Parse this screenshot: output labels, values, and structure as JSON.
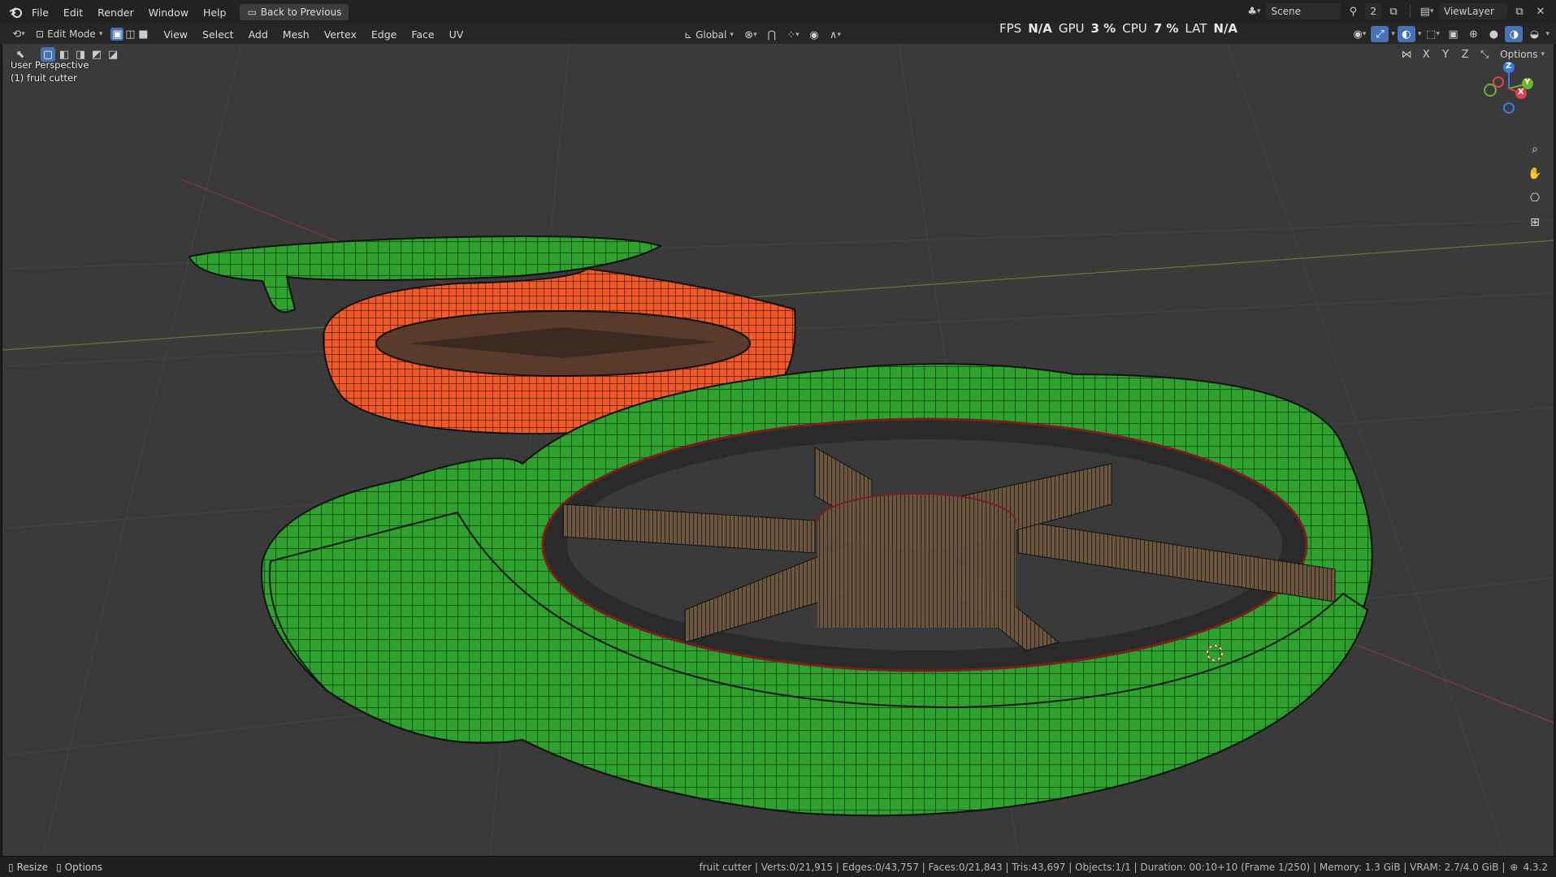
{
  "topbar": {
    "menus": [
      "File",
      "Edit",
      "Render",
      "Window",
      "Help"
    ],
    "back_button": "Back to Previous",
    "scene_label": "Scene",
    "scene_users": "2",
    "viewlayer_label": "ViewLayer"
  },
  "header": {
    "mode": "Edit Mode",
    "menus": [
      "View",
      "Select",
      "Add",
      "Mesh",
      "Vertex",
      "Edge",
      "Face",
      "UV"
    ],
    "orientation": "Global",
    "options_label": "Options",
    "axes": [
      "X",
      "Y",
      "Z"
    ]
  },
  "perf": {
    "fps_label": "FPS",
    "fps_value": "N/A",
    "gpu_label": "GPU",
    "gpu_value": "3 %",
    "cpu_label": "CPU",
    "cpu_value": "7 %",
    "lat_label": "LAT",
    "lat_value": "N/A"
  },
  "viewport": {
    "perspective": "User Perspective",
    "object": "(1) fruit cutter"
  },
  "gizmo": {
    "x": "X",
    "y": "Y",
    "z": "Z"
  },
  "statusbar": {
    "resize": "Resize",
    "options": "Options",
    "stats": "fruit cutter | Verts:0/21,915 | Edges:0/43,757 | Faces:0/21,843 | Tris:43,697 | Objects:1/1 | Duration: 00:10+10 (Frame 1/250) | Memory: 1.3 GiB | VRAM: 2.7/4.0 GiB |",
    "version": "4.3.2"
  },
  "colors": {
    "green_mesh": "#2ea12e",
    "orange_mesh": "#f05a2a",
    "accent": "#4772b3"
  }
}
